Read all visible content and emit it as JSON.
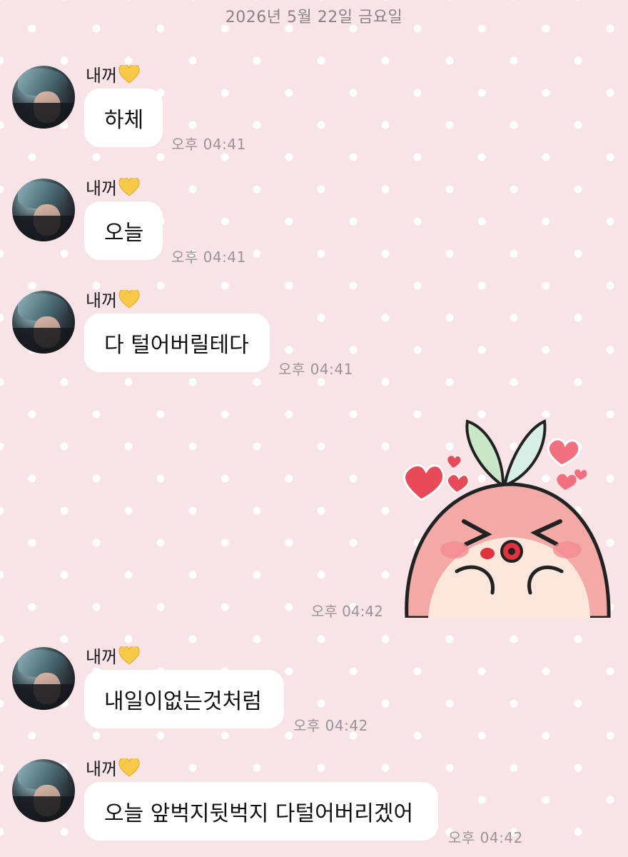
{
  "header": {
    "date": "2026년 5월 22일 금요일"
  },
  "sender": {
    "name": "내꺼",
    "badge_icon": "yellow-heart-icon",
    "badge_color": "#f7c948"
  },
  "messages": [
    {
      "text": "하체",
      "time": "오후 04:41"
    },
    {
      "text": "오늘",
      "time": "오후 04:41"
    },
    {
      "text": "다 털어버릴테다",
      "time": "오후 04:41"
    },
    {
      "text": "내일이없는것처럼",
      "time": "오후 04:42"
    },
    {
      "text": "오늘 앞벅지뒷벅지 다털어버리겠어",
      "time": "오후 04:42"
    }
  ],
  "sticker": {
    "icon": "peach-kiss-sticker",
    "time": "오후 04:42"
  },
  "colors": {
    "background": "#f8e4e6",
    "bubble": "#ffffff",
    "timestamp": "#9b9395"
  }
}
